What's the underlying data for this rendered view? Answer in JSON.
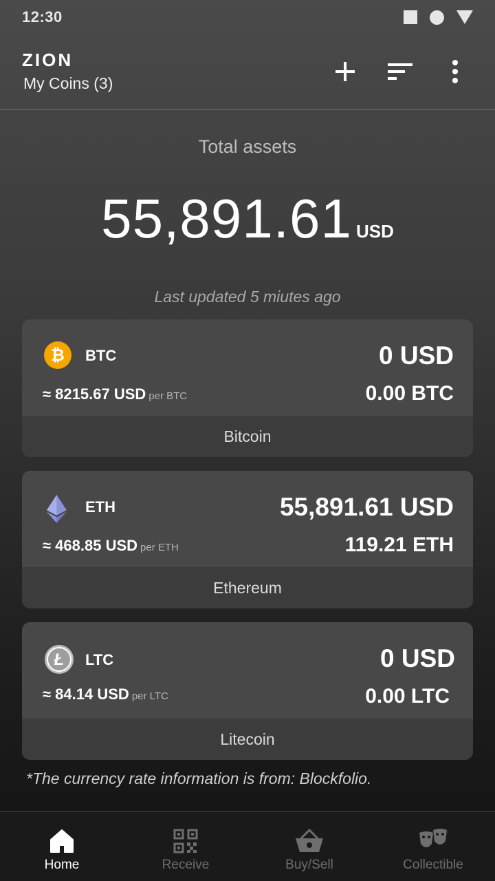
{
  "status_bar": {
    "time": "12:30"
  },
  "app_bar": {
    "title": "ZION",
    "subtitle": "My Coins (3)",
    "actions": [
      "add-icon",
      "sort-icon",
      "more-vert-icon"
    ]
  },
  "summary": {
    "label": "Total assets",
    "value": "55,891.61",
    "unit": "USD",
    "last_updated": "Last updated 5 miutes ago"
  },
  "coins": [
    {
      "symbol": "BTC",
      "usd_value": "0 USD",
      "rate": "≈ 8215.67 USD",
      "per": "per BTC",
      "amount": "0.00 BTC",
      "name": "Bitcoin",
      "icon": "bitcoin-icon",
      "color": "#F7A600"
    },
    {
      "symbol": "ETH",
      "usd_value": "55,891.61 USD",
      "rate": "≈ 468.85 USD",
      "per": "per ETH",
      "amount": "119.21 ETH",
      "name": "Ethereum",
      "icon": "ethereum-icon",
      "color": "#8A92D8"
    },
    {
      "symbol": "LTC",
      "usd_value": "0 USD",
      "rate": "≈ 84.14 USD",
      "per": "per LTC",
      "amount": "0.00 LTC",
      "name": "Litecoin",
      "icon": "litecoin-icon",
      "color": "#BDBDBD"
    }
  ],
  "footnote": "*The currency rate information is from: Blockfolio.",
  "bottom_nav": [
    {
      "label": "Home",
      "icon": "home-icon",
      "active": true
    },
    {
      "label": "Receive",
      "icon": "qr-code-icon",
      "active": false
    },
    {
      "label": "Buy/Sell",
      "icon": "basket-icon",
      "active": false
    },
    {
      "label": "Collectible",
      "icon": "theater-masks-icon",
      "active": false
    }
  ]
}
